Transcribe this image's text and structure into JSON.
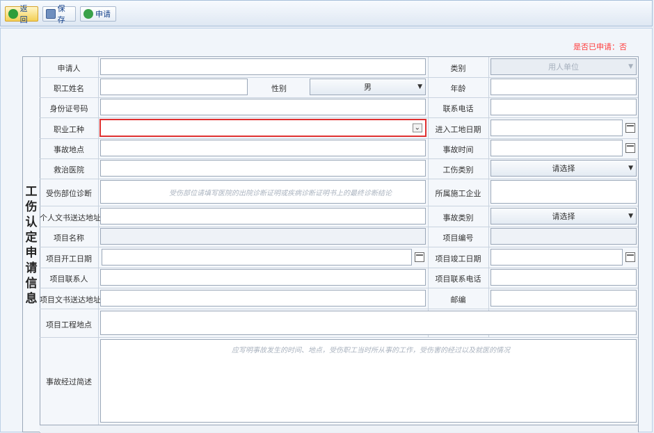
{
  "toolbar": {
    "back_label": "返回",
    "save_label": "保存",
    "apply_label": "申请"
  },
  "status_text": "是否已申请：否",
  "vertical_title": [
    "工",
    "伤",
    "认",
    "定",
    "申",
    "请",
    "信",
    "息"
  ],
  "labels": {
    "applicant": "申请人",
    "category": "类别",
    "worker_name": "职工姓名",
    "gender": "性别",
    "age": "年龄",
    "id_number": "身份证号码",
    "phone": "联系电话",
    "occupation": "职业工种",
    "entry_date": "进入工地日期",
    "accident_place": "事故地点",
    "accident_time": "事故时间",
    "hospital": "救治医院",
    "injury_type": "工伤类别",
    "injury_diagnosis": "受伤部位诊断",
    "construction_company": "所属施工企业",
    "personal_address": "个人文书送达地址",
    "accident_type": "事故类别",
    "project_name": "项目名称",
    "project_number": "项目编号",
    "project_start": "项目开工日期",
    "project_end": "项目竣工日期",
    "project_contact": "项目联系人",
    "project_phone": "项目联系电话",
    "project_address": "项目文书送达地址",
    "postcode": "邮编",
    "project_site": "项目工程地点",
    "accident_description": "事故经过简述"
  },
  "values": {
    "category": "用人单位",
    "gender": "男",
    "injury_type": "请选择",
    "accident_type": "请选择"
  },
  "placeholders": {
    "injury_diagnosis": "受伤部位请填写医院的出院诊断证明或疾病诊断证明书上的最终诊断结论",
    "accident_description": "应写明事故发生的时间、地点，受伤职工当时所从事的工作，受伤害的经过以及就医的情况"
  },
  "colors": {
    "status_red": "#ff3b3b",
    "highlight_red": "#e03030"
  }
}
